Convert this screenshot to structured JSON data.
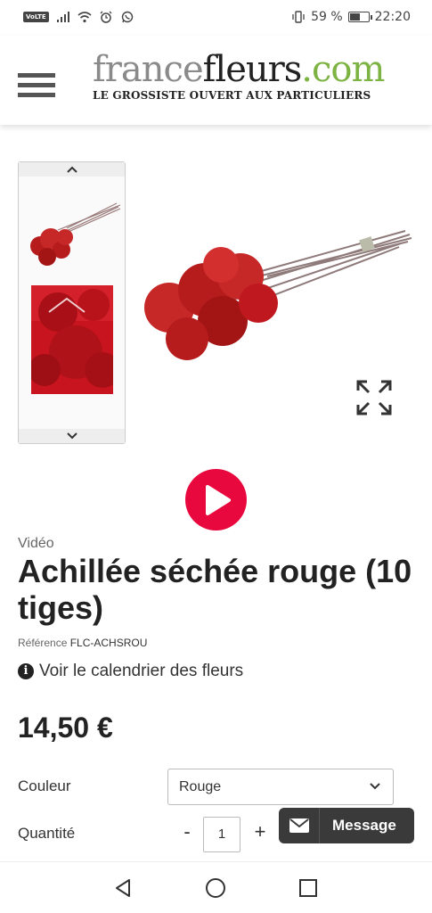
{
  "status_bar": {
    "volte": "VoLTE",
    "battery_text": "59 %",
    "battery_level": 0.59,
    "time": "22:20"
  },
  "header": {
    "logo_france": "france",
    "logo_fleurs": "fleurs",
    "logo_com": ".com",
    "tagline": "LE GROSSISTE OUVERT AUX PARTICULIERS"
  },
  "product": {
    "video_label": "Vidéo",
    "title": "Achillée séchée rouge (10 tiges)",
    "reference_label": "Référence",
    "reference_value": "FLC-ACHSROU",
    "calendar_link": "Voir le calendrier des fleurs",
    "price": "14,50 €",
    "color_label": "Couleur",
    "color_selected": "Rouge",
    "quantity_label": "Quantité",
    "quantity_minus": "-",
    "quantity_value": "1",
    "quantity_plus": "+"
  },
  "chat": {
    "label": "Message"
  },
  "colors": {
    "accent_red": "#e8083e",
    "logo_green": "#7cb342",
    "flower_red": "#c8141e"
  }
}
